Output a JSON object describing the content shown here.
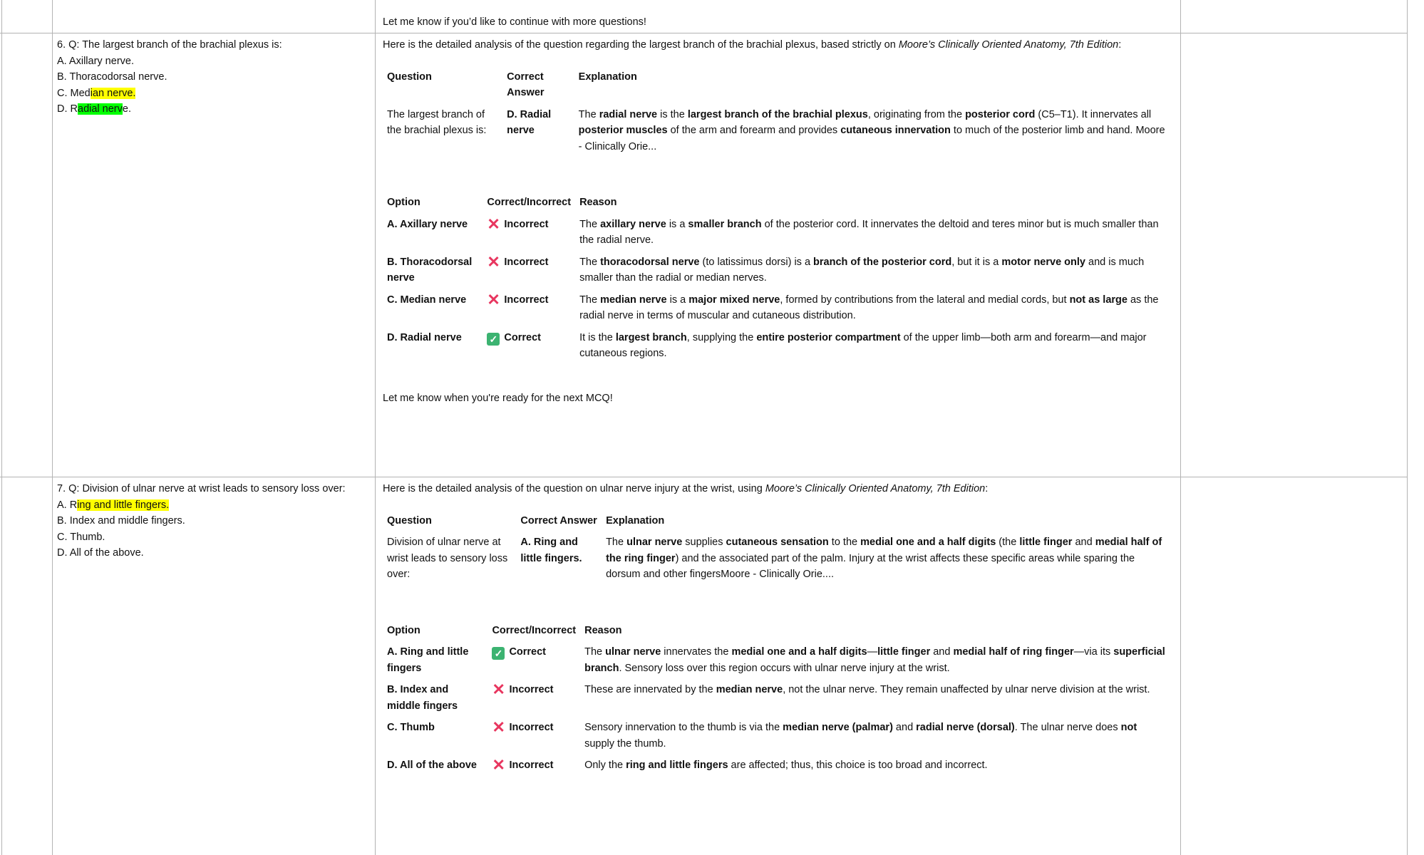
{
  "top_note": "Let me know if you’d like to continue with more questions!",
  "rows": [
    {
      "question_lines": [
        {
          "pre": "6. Q: The largest branch of the brachial plexus is:",
          "hl": "",
          "post": "",
          "hl_color": ""
        },
        {
          "pre": "A. Axillary nerve.",
          "hl": "",
          "post": "",
          "hl_color": ""
        },
        {
          "pre": "B. Thoracodorsal nerve.",
          "hl": "",
          "post": "",
          "hl_color": ""
        },
        {
          "pre": "C. Med",
          "hl": "ian nerve.",
          "post": "",
          "hl_color": "yellow"
        },
        {
          "pre": "D. R",
          "hl": "adial nerv",
          "post": "e.",
          "hl_color": "green"
        }
      ],
      "intro_pre": "Here is the detailed analysis of the question regarding the largest branch of the brachial plexus, based strictly on ",
      "intro_em": "Moore’s Clinically Oriented Anatomy, 7th Edition",
      "intro_post": ":",
      "summary_headers": [
        "Question",
        "Correct Answer",
        "Explanation"
      ],
      "summary": {
        "question": "The largest branch of the brachial plexus is:",
        "answer": "D. Radial nerve",
        "explanation": [
          {
            "t": "The ",
            "b": false
          },
          {
            "t": "radial nerve",
            "b": true
          },
          {
            "t": " is the ",
            "b": false
          },
          {
            "t": "largest branch of the brachial plexus",
            "b": true
          },
          {
            "t": ", originating from the ",
            "b": false
          },
          {
            "t": "posterior cord",
            "b": true
          },
          {
            "t": " (C5–T1). It innervates all ",
            "b": false
          },
          {
            "t": "posterior muscles",
            "b": true
          },
          {
            "t": " of the arm and forearm and provides ",
            "b": false
          },
          {
            "t": "cutaneous innervation",
            "b": true
          },
          {
            "t": " to much of the posterior limb and hand. Moore - Clinically Orie...",
            "b": false
          }
        ]
      },
      "option_headers": [
        "Option",
        "Correct/Incorrect",
        "Reason"
      ],
      "options": [
        {
          "option": "A. Axillary nerve",
          "mark": "x",
          "verdict": "Incorrect",
          "reason": [
            {
              "t": "The ",
              "b": false
            },
            {
              "t": "axillary nerve",
              "b": true
            },
            {
              "t": " is a ",
              "b": false
            },
            {
              "t": "smaller branch",
              "b": true
            },
            {
              "t": " of the posterior cord. It innervates the deltoid and teres minor but is much smaller than the radial nerve.",
              "b": false
            }
          ]
        },
        {
          "option": "B. Thoracodorsal nerve",
          "mark": "x",
          "verdict": "Incorrect",
          "reason": [
            {
              "t": "The ",
              "b": false
            },
            {
              "t": "thoracodorsal nerve",
              "b": true
            },
            {
              "t": " (to latissimus dorsi) is a ",
              "b": false
            },
            {
              "t": "branch of the posterior cord",
              "b": true
            },
            {
              "t": ", but it is a ",
              "b": false
            },
            {
              "t": "motor nerve only",
              "b": true
            },
            {
              "t": " and is much smaller than the radial or median nerves.",
              "b": false
            }
          ]
        },
        {
          "option": "C. Median nerve",
          "mark": "x",
          "verdict": "Incorrect",
          "reason": [
            {
              "t": "The ",
              "b": false
            },
            {
              "t": "median nerve",
              "b": true
            },
            {
              "t": " is a ",
              "b": false
            },
            {
              "t": "major mixed nerve",
              "b": true
            },
            {
              "t": ", formed by contributions from the lateral and medial cords, but ",
              "b": false
            },
            {
              "t": "not as large",
              "b": true
            },
            {
              "t": " as the radial nerve in terms of muscular and cutaneous distribution.",
              "b": false
            }
          ]
        },
        {
          "option": "D. Radial nerve",
          "mark": "check",
          "verdict": "Correct",
          "reason": [
            {
              "t": "It is the ",
              "b": false
            },
            {
              "t": "largest branch",
              "b": true
            },
            {
              "t": ", supplying the ",
              "b": false
            },
            {
              "t": "entire posterior compartment",
              "b": true
            },
            {
              "t": " of the upper limb—both arm and forearm—and major cutaneous regions.",
              "b": false
            }
          ]
        }
      ],
      "outro": "Let me know when you're ready for the next MCQ!"
    },
    {
      "question_lines": [
        {
          "pre": "7. Q: Division of ulnar nerve at wrist leads to sensory loss over:",
          "hl": "",
          "post": "",
          "hl_color": ""
        },
        {
          "pre": "A. R",
          "hl": "ing and little fingers.",
          "post": "",
          "hl_color": "yellow"
        },
        {
          "pre": "B. Index and middle fingers.",
          "hl": "",
          "post": "",
          "hl_color": ""
        },
        {
          "pre": "C. Thumb.",
          "hl": "",
          "post": "",
          "hl_color": ""
        },
        {
          "pre": "D. All of the above.",
          "hl": "",
          "post": "",
          "hl_color": ""
        }
      ],
      "intro_pre": "Here is the detailed analysis of the question on ulnar nerve injury at the wrist, using ",
      "intro_em": "Moore’s Clinically Oriented Anatomy, 7th Edition",
      "intro_post": ":",
      "summary_headers": [
        "Question",
        "Correct Answer",
        "Explanation"
      ],
      "summary": {
        "question": "Division of ulnar nerve at wrist leads to sensory loss over:",
        "answer": "A. Ring and little fingers.",
        "explanation": [
          {
            "t": "The ",
            "b": false
          },
          {
            "t": "ulnar nerve",
            "b": true
          },
          {
            "t": " supplies ",
            "b": false
          },
          {
            "t": "cutaneous sensation",
            "b": true
          },
          {
            "t": " to the ",
            "b": false
          },
          {
            "t": "medial one and a half digits",
            "b": true
          },
          {
            "t": " (the ",
            "b": false
          },
          {
            "t": "little finger",
            "b": true
          },
          {
            "t": " and ",
            "b": false
          },
          {
            "t": "medial half of the ring finger",
            "b": true
          },
          {
            "t": ") and the associated part of the palm. Injury at the wrist affects these specific areas while sparing the dorsum and other fingersMoore - Clinically Orie....",
            "b": false
          }
        ]
      },
      "option_headers": [
        "Option",
        "Correct/Incorrect",
        "Reason"
      ],
      "options": [
        {
          "option": "A. Ring and little fingers",
          "mark": "check",
          "verdict": "Correct",
          "reason": [
            {
              "t": "The ",
              "b": false
            },
            {
              "t": "ulnar nerve",
              "b": true
            },
            {
              "t": " innervates the ",
              "b": false
            },
            {
              "t": "medial one and a half digits",
              "b": true
            },
            {
              "t": "—",
              "b": false
            },
            {
              "t": "little finger",
              "b": true
            },
            {
              "t": " and ",
              "b": false
            },
            {
              "t": "medial half of ring finger",
              "b": true
            },
            {
              "t": "—via its ",
              "b": false
            },
            {
              "t": "superficial branch",
              "b": true
            },
            {
              "t": ". Sensory loss over this region occurs with ulnar nerve injury at the wrist.",
              "b": false
            }
          ]
        },
        {
          "option": "B. Index and middle fingers",
          "mark": "x",
          "verdict": "Incorrect",
          "reason": [
            {
              "t": "These are innervated by the ",
              "b": false
            },
            {
              "t": "median nerve",
              "b": true
            },
            {
              "t": ", not the ulnar nerve. They remain unaffected by ulnar nerve division at the wrist.",
              "b": false
            }
          ]
        },
        {
          "option": "C. Thumb",
          "mark": "x",
          "verdict": "Incorrect",
          "reason": [
            {
              "t": "Sensory innervation to the thumb is via the ",
              "b": false
            },
            {
              "t": "median nerve (palmar)",
              "b": true
            },
            {
              "t": " and ",
              "b": false
            },
            {
              "t": "radial nerve (dorsal)",
              "b": true
            },
            {
              "t": ". The ulnar nerve does ",
              "b": false
            },
            {
              "t": "not",
              "b": true
            },
            {
              "t": " supply the thumb.",
              "b": false
            }
          ]
        },
        {
          "option": "D. All of the above",
          "mark": "x",
          "verdict": "Incorrect",
          "reason": [
            {
              "t": "Only the ",
              "b": false
            },
            {
              "t": "ring and little fingers",
              "b": true
            },
            {
              "t": " are affected; thus, this choice is too broad and incorrect.",
              "b": false
            }
          ]
        }
      ],
      "outro": ""
    }
  ]
}
